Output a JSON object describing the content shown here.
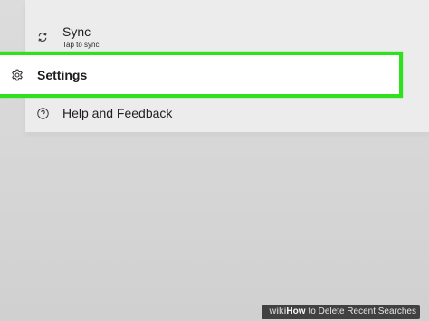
{
  "menu": {
    "sync": {
      "icon": "sync-icon",
      "label": "Sync",
      "sublabel": "Tap to sync"
    },
    "settings": {
      "icon": "gear-icon",
      "label": "Settings",
      "highlight_color": "#2fe01f"
    },
    "help": {
      "icon": "help-circle-icon",
      "label": "Help and Feedback"
    }
  },
  "watermark": {
    "wiki": "wiki",
    "how": "How",
    "title": "to Delete Recent Searches"
  },
  "colors": {
    "background": "#d6d6d6",
    "panel": "#ececec",
    "highlight": "#2fe01f",
    "text": "#1f1f1f"
  }
}
